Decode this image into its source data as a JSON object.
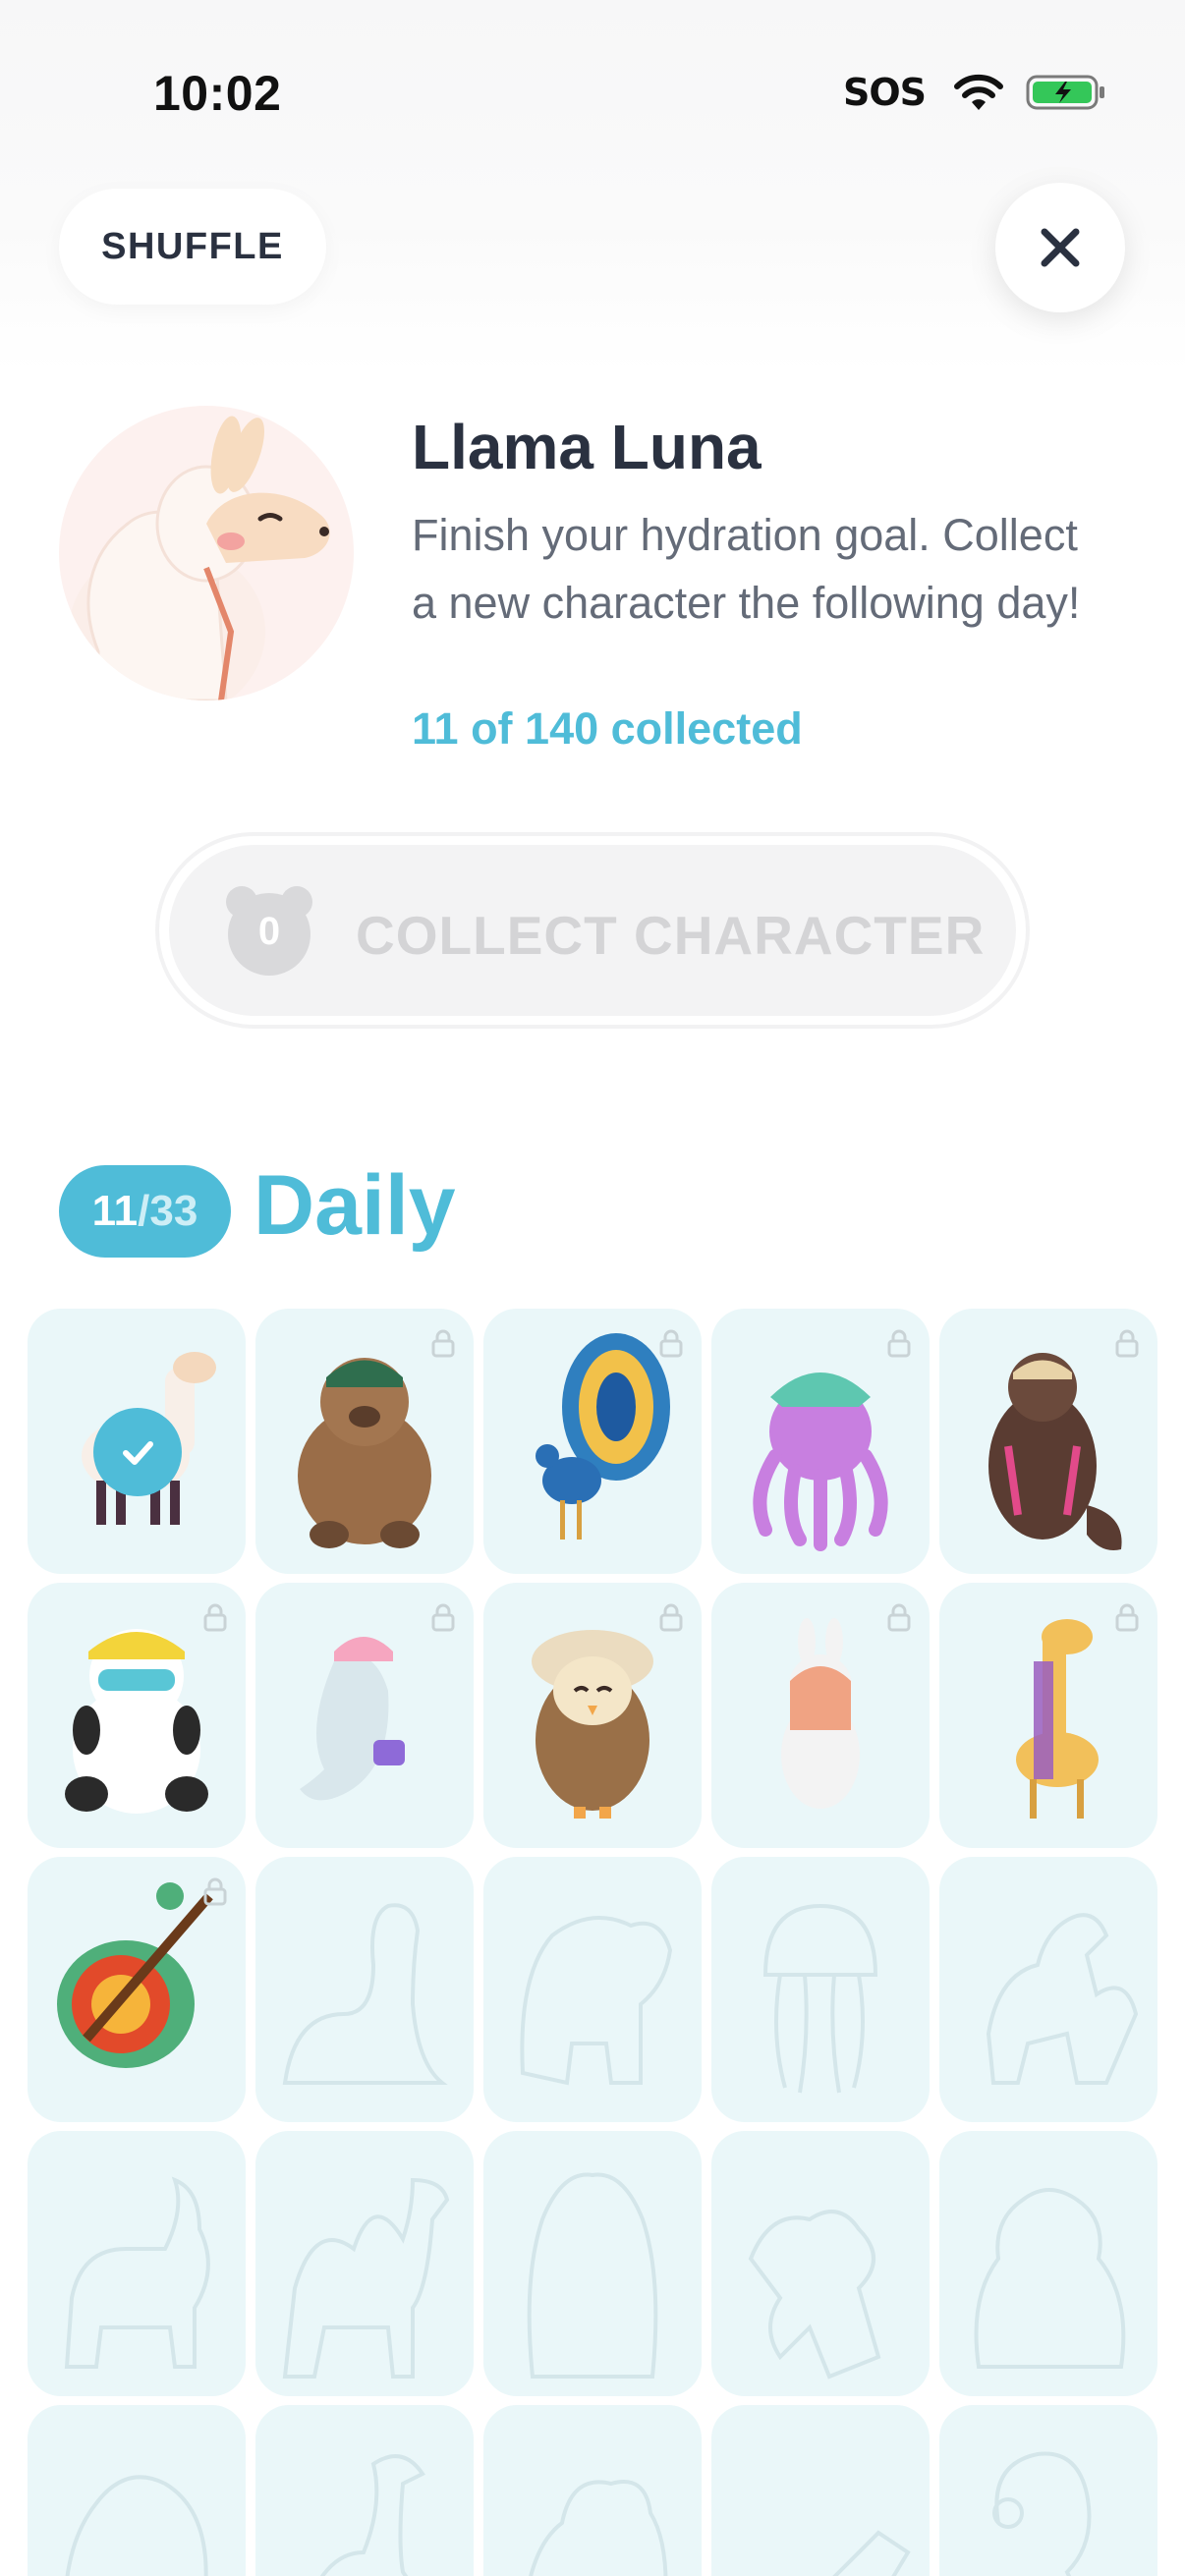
{
  "status_bar": {
    "time": "10:02",
    "carrier": "SOS"
  },
  "toolbar": {
    "shuffle_label": "SHUFFLE"
  },
  "character": {
    "name": "Llama Luna",
    "description": "Finish your hydration goal. Collect a new character the following day!",
    "progress_text": "11 of 140 collected"
  },
  "collect": {
    "badge_count": "0",
    "label": "COLLECT CHARACTER"
  },
  "section": {
    "count_current": "11",
    "count_separator": "/",
    "count_total": "33",
    "title": "Daily"
  },
  "colors": {
    "accent": "#4fbcd8",
    "tile_bg": "#eaf7f9",
    "text_dark": "#2a3140",
    "text_muted": "#646b78",
    "disabled_text": "#d4d4d6"
  },
  "grid": [
    {
      "name": "llama",
      "state": "selected"
    },
    {
      "name": "bear",
      "state": "locked"
    },
    {
      "name": "peacock",
      "state": "locked"
    },
    {
      "name": "octopus",
      "state": "locked"
    },
    {
      "name": "otter",
      "state": "locked"
    },
    {
      "name": "panda",
      "state": "locked"
    },
    {
      "name": "beluga",
      "state": "locked"
    },
    {
      "name": "owl",
      "state": "locked"
    },
    {
      "name": "bunny",
      "state": "locked"
    },
    {
      "name": "giraffe",
      "state": "locked"
    },
    {
      "name": "turtle",
      "state": "locked"
    },
    {
      "name": "dinosaur",
      "state": "silhouette"
    },
    {
      "name": "elephant",
      "state": "silhouette"
    },
    {
      "name": "jellyfish",
      "state": "silhouette"
    },
    {
      "name": "horse",
      "state": "silhouette"
    },
    {
      "name": "goat",
      "state": "silhouette"
    },
    {
      "name": "camel",
      "state": "silhouette"
    },
    {
      "name": "hamster",
      "state": "silhouette"
    },
    {
      "name": "dog",
      "state": "silhouette"
    },
    {
      "name": "raccoon",
      "state": "silhouette"
    },
    {
      "name": "pig",
      "state": "silhouette"
    },
    {
      "name": "ostrich",
      "state": "silhouette"
    },
    {
      "name": "frog",
      "state": "silhouette"
    },
    {
      "name": "crocodile",
      "state": "silhouette"
    },
    {
      "name": "flamingo",
      "state": "silhouette"
    }
  ]
}
